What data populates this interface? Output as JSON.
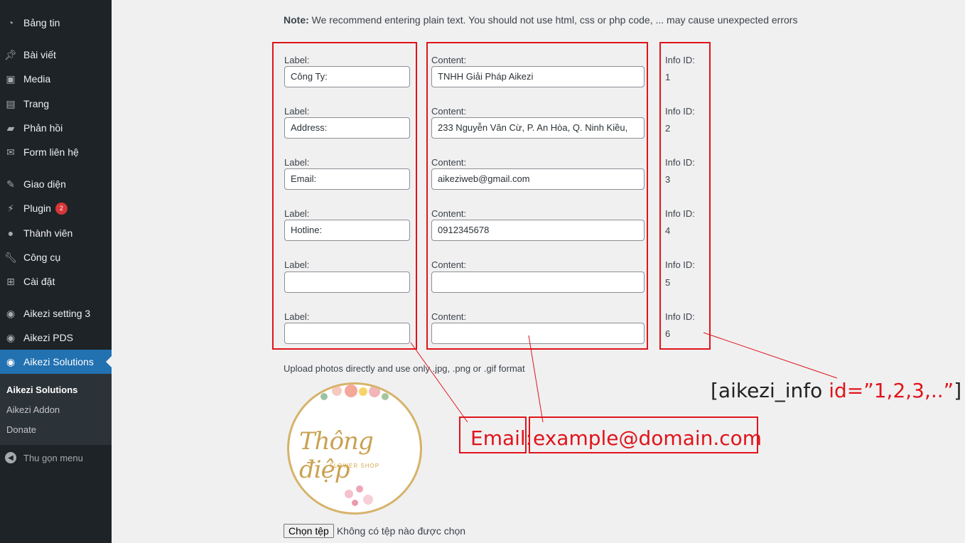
{
  "sidebar": {
    "items": [
      {
        "label": "Bảng tin",
        "icon": "dashboard-icon"
      },
      {
        "label": "Bài viết",
        "icon": "pin-icon"
      },
      {
        "label": "Media",
        "icon": "media-icon"
      },
      {
        "label": "Trang",
        "icon": "page-icon"
      },
      {
        "label": "Phản hồi",
        "icon": "comment-icon"
      },
      {
        "label": "Form liên hệ",
        "icon": "mail-icon"
      },
      {
        "label": "Giao diện",
        "icon": "brush-icon"
      },
      {
        "label": "Plugin",
        "icon": "plugin-icon",
        "badge": "2"
      },
      {
        "label": "Thành viên",
        "icon": "user-icon"
      },
      {
        "label": "Công cụ",
        "icon": "wrench-icon"
      },
      {
        "label": "Cài đặt",
        "icon": "settings-icon"
      },
      {
        "label": "Aikezi setting 3",
        "icon": "aikezi-icon"
      },
      {
        "label": "Aikezi PDS",
        "icon": "aikezi-icon"
      },
      {
        "label": "Aikezi Solutions",
        "icon": "aikezi-icon"
      }
    ],
    "submenu": [
      "Aikezi Solutions",
      "Aikezi Addon",
      "Donate"
    ],
    "collapse_label": "Thu gọn menu"
  },
  "main": {
    "note_bold": "Note:",
    "note_text": " We recommend entering plain text. You should not use html, css or php code, ... may cause unexpected errors",
    "label_caption": "Label:",
    "content_caption": "Content:",
    "id_caption": "Info ID:",
    "rows": [
      {
        "label": "Công Ty:",
        "content": "TNHH Giải Pháp Aikezi",
        "id": "1"
      },
      {
        "label": "Address:",
        "content": "233 Nguyễn Văn Cừ, P. An Hòa, Q. Ninh Kiều,",
        "id": "2"
      },
      {
        "label": "Email:",
        "content": "aikeziweb@gmail.com",
        "id": "3"
      },
      {
        "label": "Hotline:",
        "content": "0912345678",
        "id": "4"
      },
      {
        "label": "",
        "content": "",
        "id": "5"
      },
      {
        "label": "",
        "content": "",
        "id": "6"
      }
    ],
    "upload_note": "Upload photos directly and use only .jpg, .png or .gif format",
    "logo_text": "Thông điệp",
    "logo_subtext": "FLOWER SHOP",
    "file_button": "Chọn tệp",
    "file_status": "Không có tệp nào được chọn"
  },
  "annotations": {
    "label_example": "Email:",
    "content_example": "example@domain.com",
    "shortcode_prefix": "[aikezi_info ",
    "shortcode_attr": "id=”1,2,3,..”",
    "shortcode_suffix": "]"
  },
  "colors": {
    "sidebar_bg": "#1d2327",
    "active_bg": "#2271b1",
    "annotation_red": "#e0141a",
    "page_bg": "#f0f0f1"
  }
}
